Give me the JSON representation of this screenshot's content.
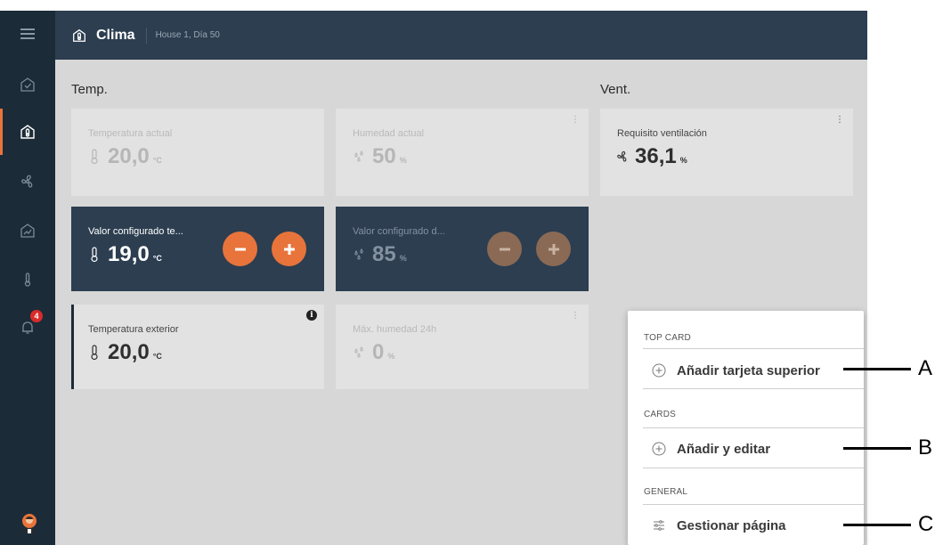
{
  "header": {
    "title": "Clima",
    "subtitle": "House 1, Día 50"
  },
  "sidebar": {
    "items": [
      {
        "icon": "menu-icon"
      },
      {
        "icon": "dashboard-check-icon"
      },
      {
        "icon": "climate-house-icon",
        "active": true
      },
      {
        "icon": "fan-icon"
      },
      {
        "icon": "chart-icon"
      },
      {
        "icon": "thermometer-icon"
      },
      {
        "icon": "bell-icon",
        "badge": "4"
      }
    ],
    "badge_count": "4"
  },
  "sections": {
    "temp_title": "Temp.",
    "vent_title": "Vent."
  },
  "cards": {
    "temp_actual": {
      "label": "Temperatura actual",
      "value": "20,0",
      "unit": "°C"
    },
    "humidity_actual": {
      "label": "Humedad actual",
      "value": "50",
      "unit": "%"
    },
    "vent_requirement": {
      "label": "Requisito ventilación",
      "value": "36,1",
      "unit": "%"
    },
    "temp_setpoint": {
      "label": "Valor configurado te...",
      "value": "19,0",
      "unit": "°C"
    },
    "humidity_setpoint": {
      "label": "Valor configurado d...",
      "value": "85",
      "unit": "%"
    },
    "temp_outside": {
      "label": "Temperatura exterior",
      "value": "20,0",
      "unit": "°C"
    },
    "max_humidity": {
      "label": "Máx. humedad 24h",
      "value": "0",
      "unit": "%"
    }
  },
  "menu": {
    "top_card_section": "TOP CARD",
    "add_top_card": "Añadir tarjeta superior",
    "cards_section": "CARDS",
    "add_edit": "Añadir y editar",
    "general_section": "GENERAL",
    "manage_page": "Gestionar página"
  },
  "callouts": {
    "a": "A",
    "b": "B",
    "c": "C"
  },
  "colors": {
    "sidebar_bg": "#1c2b38",
    "header_bg": "#2c3e50",
    "accent": "#e8743b",
    "content_bg": "#d7d7d7",
    "card_bg": "#e2e2e2",
    "badge": "#d92b2b"
  }
}
